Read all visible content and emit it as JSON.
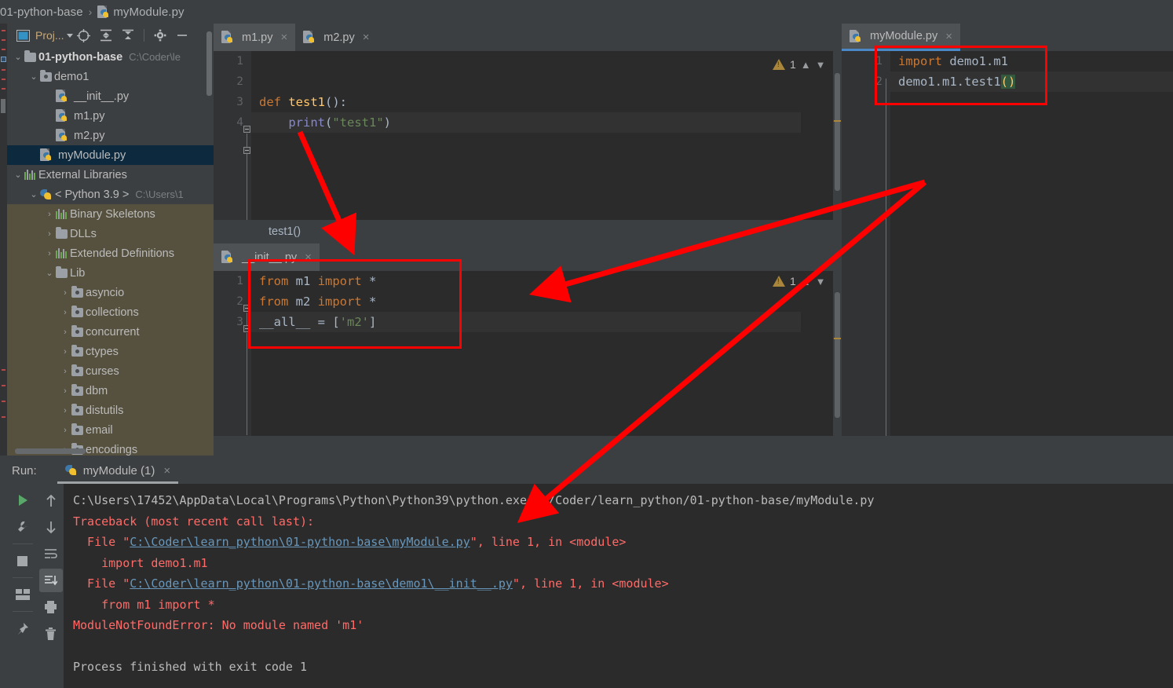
{
  "window": {
    "breadcrumb": {
      "project": "01-python-base",
      "separator": "›",
      "file": "myModule.py"
    }
  },
  "project_panel": {
    "title": "Proj...",
    "toolbar_icons": [
      "project-view-icon",
      "locate-icon",
      "expand-all-icon",
      "collapse-all-icon",
      "settings-gear-icon",
      "hide-icon"
    ],
    "tree": [
      {
        "label": "01-python-base",
        "path": "C:\\Coder\\le",
        "icon": "folder-icon",
        "depth": 0,
        "twisty": "⌄",
        "bold": true
      },
      {
        "label": "demo1",
        "path": "",
        "icon": "source-folder-icon",
        "depth": 1,
        "twisty": "⌄",
        "bold": false
      },
      {
        "label": "__init__.py",
        "path": "",
        "icon": "python-file-icon",
        "depth": 2,
        "twisty": "",
        "bold": false
      },
      {
        "label": "m1.py",
        "path": "",
        "icon": "python-file-icon",
        "depth": 2,
        "twisty": "",
        "bold": false
      },
      {
        "label": "m2.py",
        "path": "",
        "icon": "python-file-icon",
        "depth": 2,
        "twisty": "",
        "bold": false
      },
      {
        "label": "myModule.py",
        "path": "",
        "icon": "python-file-icon",
        "depth": 1,
        "twisty": "",
        "bold": false,
        "selected": true
      },
      {
        "label": "External Libraries",
        "path": "",
        "icon": "library-icon",
        "depth": 0,
        "twisty": "⌄",
        "bold": false
      },
      {
        "label": "< Python 3.9 >",
        "path": "C:\\Users\\1",
        "icon": "python-icon",
        "depth": 1,
        "twisty": "⌄",
        "bold": false
      },
      {
        "label": "Binary Skeletons",
        "path": "",
        "icon": "library-icon",
        "depth": 2,
        "twisty": "›",
        "bold": false,
        "lib": true
      },
      {
        "label": "DLLs",
        "path": "",
        "icon": "folder-icon",
        "depth": 2,
        "twisty": "›",
        "bold": false,
        "lib": true
      },
      {
        "label": "Extended Definitions",
        "path": "",
        "icon": "library-icon",
        "depth": 2,
        "twisty": "›",
        "bold": false,
        "lib": true
      },
      {
        "label": "Lib",
        "path": "",
        "icon": "folder-icon",
        "depth": 2,
        "twisty": "⌄",
        "bold": false,
        "lib": true
      },
      {
        "label": "asyncio",
        "path": "",
        "icon": "source-folder-icon",
        "depth": 3,
        "twisty": "›",
        "bold": false,
        "lib": true
      },
      {
        "label": "collections",
        "path": "",
        "icon": "source-folder-icon",
        "depth": 3,
        "twisty": "›",
        "bold": false,
        "lib": true
      },
      {
        "label": "concurrent",
        "path": "",
        "icon": "source-folder-icon",
        "depth": 3,
        "twisty": "›",
        "bold": false,
        "lib": true
      },
      {
        "label": "ctypes",
        "path": "",
        "icon": "source-folder-icon",
        "depth": 3,
        "twisty": "›",
        "bold": false,
        "lib": true
      },
      {
        "label": "curses",
        "path": "",
        "icon": "source-folder-icon",
        "depth": 3,
        "twisty": "›",
        "bold": false,
        "lib": true
      },
      {
        "label": "dbm",
        "path": "",
        "icon": "source-folder-icon",
        "depth": 3,
        "twisty": "›",
        "bold": false,
        "lib": true
      },
      {
        "label": "distutils",
        "path": "",
        "icon": "source-folder-icon",
        "depth": 3,
        "twisty": "›",
        "bold": false,
        "lib": true
      },
      {
        "label": "email",
        "path": "",
        "icon": "source-folder-icon",
        "depth": 3,
        "twisty": "›",
        "bold": false,
        "lib": true
      },
      {
        "label": "encodings",
        "path": "",
        "icon": "source-folder-icon",
        "depth": 3,
        "twisty": "›",
        "bold": false,
        "lib": true
      }
    ]
  },
  "editor_m1": {
    "tabs": [
      {
        "label": "m1.py",
        "active": true,
        "close": "×"
      },
      {
        "label": "m2.py",
        "active": false,
        "close": "×"
      }
    ],
    "line_numbers": [
      "1",
      "2",
      "3",
      "4"
    ],
    "warning_count": "1",
    "code_lines": [
      {
        "n": "1",
        "text": ""
      },
      {
        "n": "2",
        "text": ""
      },
      {
        "n": "3",
        "text": "def test1():"
      },
      {
        "n": "4",
        "text": "    print(\"test1\")"
      }
    ],
    "breadcrumb": "test1()"
  },
  "editor_init": {
    "tabs": [
      {
        "label": "__init__.py",
        "active": true,
        "close": "×"
      }
    ],
    "warning_count": "1",
    "line_numbers": [
      "1",
      "2",
      "3"
    ],
    "code_lines": [
      {
        "n": "1",
        "text": "from m1 import *"
      },
      {
        "n": "2",
        "text": "from m2 import *"
      },
      {
        "n": "3",
        "text": "__all__ = ['m2']"
      }
    ]
  },
  "editor_mymodule": {
    "tabs": [
      {
        "label": "myModule.py",
        "active": true,
        "close": "×"
      }
    ],
    "line_numbers": [
      "1",
      "2"
    ],
    "code_lines": [
      {
        "n": "1",
        "text": "import demo1.m1"
      },
      {
        "n": "2",
        "text": "demo1.m1.test1()"
      }
    ]
  },
  "run_panel": {
    "label": "Run:",
    "tab_label": "myModule (1)",
    "tab_close": "×",
    "left_icons": [
      "rerun-run-icon",
      "wrench-settings-icon",
      "stop-icon",
      "layout-icon",
      "pin-tab-icon"
    ],
    "left_icons2": [
      "up-arrow-icon",
      "down-arrow-icon",
      "soft-wrap-icon",
      "scroll-to-end-icon",
      "print-icon",
      "trash-icon"
    ],
    "console": [
      {
        "kind": "cmd",
        "text": "C:\\Users\\17452\\AppData\\Local\\Programs\\Python\\Python39\\python.exe C:/Coder/learn_python/01-python-base/myModule.py"
      },
      {
        "kind": "err",
        "text": "Traceback (most recent call last):"
      },
      {
        "kind": "file",
        "prefix": "  File \"",
        "link": "C:\\Coder\\learn_python\\01-python-base\\myModule.py",
        "suffix": "\", line 1, in <module>"
      },
      {
        "kind": "err",
        "text": "    import demo1.m1"
      },
      {
        "kind": "file",
        "prefix": "  File \"",
        "link": "C:\\Coder\\learn_python\\01-python-base\\demo1\\__init__.py",
        "suffix": "\", line 1, in <module>"
      },
      {
        "kind": "err",
        "text": "    from m1 import *"
      },
      {
        "kind": "err",
        "text": "ModuleNotFoundError: No module named 'm1'"
      },
      {
        "kind": "blank",
        "text": ""
      },
      {
        "kind": "cmd",
        "text": "Process finished with exit code 1"
      }
    ]
  },
  "annotations": {
    "highlight_color": "#ff0000",
    "boxes": [
      {
        "name": "mymodule-code-box"
      },
      {
        "name": "init-code-box"
      }
    ],
    "arrows": [
      {
        "name": "arrow-m1-to-breadcrumb"
      },
      {
        "name": "arrow-mymodule-to-init"
      },
      {
        "name": "arrow-mymodule-to-console"
      }
    ]
  }
}
